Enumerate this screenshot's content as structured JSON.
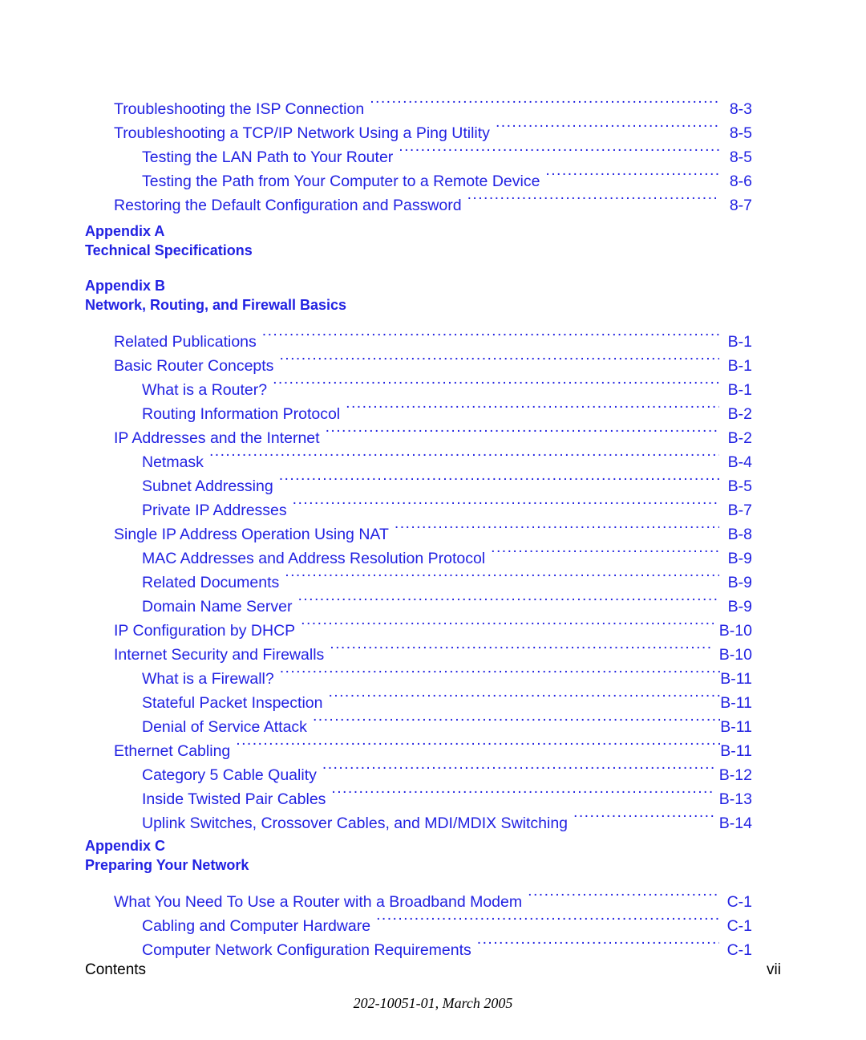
{
  "document": {
    "colors": {
      "entry_blue": "#2222e2",
      "heading_blue": "#2222e2",
      "footer_black": "#000000"
    }
  },
  "toc": {
    "entries": [
      {
        "type": "entry",
        "level": 1,
        "title": "Troubleshooting the ISP Connection",
        "page": "8-3"
      },
      {
        "type": "entry",
        "level": 1,
        "title": "Troubleshooting a TCP/IP Network Using a Ping Utility",
        "page": "8-5"
      },
      {
        "type": "entry",
        "level": 2,
        "title": "Testing the LAN Path to Your Router",
        "page": "8-5"
      },
      {
        "type": "entry",
        "level": 2,
        "title": "Testing the Path from Your Computer to a Remote Device",
        "page": "8-6"
      },
      {
        "type": "entry",
        "level": 1,
        "title": "Restoring the Default Configuration and Password",
        "page": "8-7"
      },
      {
        "type": "appendix",
        "label": "Appendix A",
        "title": "Technical Specifications"
      },
      {
        "type": "appendix",
        "label": "Appendix B",
        "title": "Network, Routing, and Firewall Basics"
      },
      {
        "type": "entry",
        "level": 1,
        "title": "Related Publications",
        "page": "B-1"
      },
      {
        "type": "entry",
        "level": 1,
        "title": "Basic Router Concepts",
        "page": "B-1"
      },
      {
        "type": "entry",
        "level": 2,
        "title": "What is a Router?",
        "page": "B-1"
      },
      {
        "type": "entry",
        "level": 2,
        "title": "Routing Information Protocol",
        "page": "B-2"
      },
      {
        "type": "entry",
        "level": 1,
        "title": "IP Addresses and the Internet",
        "page": "B-2"
      },
      {
        "type": "entry",
        "level": 2,
        "title": "Netmask",
        "page": "B-4"
      },
      {
        "type": "entry",
        "level": 2,
        "title": "Subnet Addressing",
        "page": "B-5"
      },
      {
        "type": "entry",
        "level": 2,
        "title": "Private IP Addresses",
        "page": "B-7"
      },
      {
        "type": "entry",
        "level": 1,
        "title": "Single IP Address Operation Using NAT",
        "page": "B-8"
      },
      {
        "type": "entry",
        "level": 2,
        "title": "MAC Addresses and Address Resolution Protocol",
        "page": "B-9"
      },
      {
        "type": "entry",
        "level": 2,
        "title": "Related Documents",
        "page": "B-9"
      },
      {
        "type": "entry",
        "level": 2,
        "title": "Domain Name Server",
        "page": "B-9"
      },
      {
        "type": "entry",
        "level": 1,
        "title": "IP Configuration by DHCP",
        "page": "B-10"
      },
      {
        "type": "entry",
        "level": 1,
        "title": "Internet Security and Firewalls",
        "page": "B-10"
      },
      {
        "type": "entry",
        "level": 2,
        "title": "What is a Firewall?",
        "page": "B-11"
      },
      {
        "type": "entry",
        "level": 2,
        "title": "Stateful Packet Inspection",
        "page": "B-11"
      },
      {
        "type": "entry",
        "level": 2,
        "title": "Denial of Service Attack",
        "page": "B-11"
      },
      {
        "type": "entry",
        "level": 1,
        "title": "Ethernet Cabling",
        "page": "B-11"
      },
      {
        "type": "entry",
        "level": 2,
        "title": "Category 5 Cable Quality",
        "page": "B-12"
      },
      {
        "type": "entry",
        "level": 2,
        "title": "Inside Twisted Pair Cables",
        "page": "B-13"
      },
      {
        "type": "entry",
        "level": 2,
        "title": "Uplink Switches, Crossover Cables, and MDI/MDIX Switching",
        "page": "B-14"
      },
      {
        "type": "appendix",
        "label": "Appendix C",
        "title": "Preparing Your Network"
      },
      {
        "type": "entry",
        "level": 1,
        "title": "What You Need To Use a Router with a Broadband Modem",
        "page": "C-1"
      },
      {
        "type": "entry",
        "level": 2,
        "title": "Cabling and Computer Hardware",
        "page": "C-1"
      },
      {
        "type": "entry",
        "level": 2,
        "title": "Computer Network Configuration Requirements",
        "page": "C-1"
      }
    ]
  },
  "footer": {
    "section_label": "Contents",
    "page_number": "vii",
    "doc_id": "202-10051-01, March 2005"
  }
}
